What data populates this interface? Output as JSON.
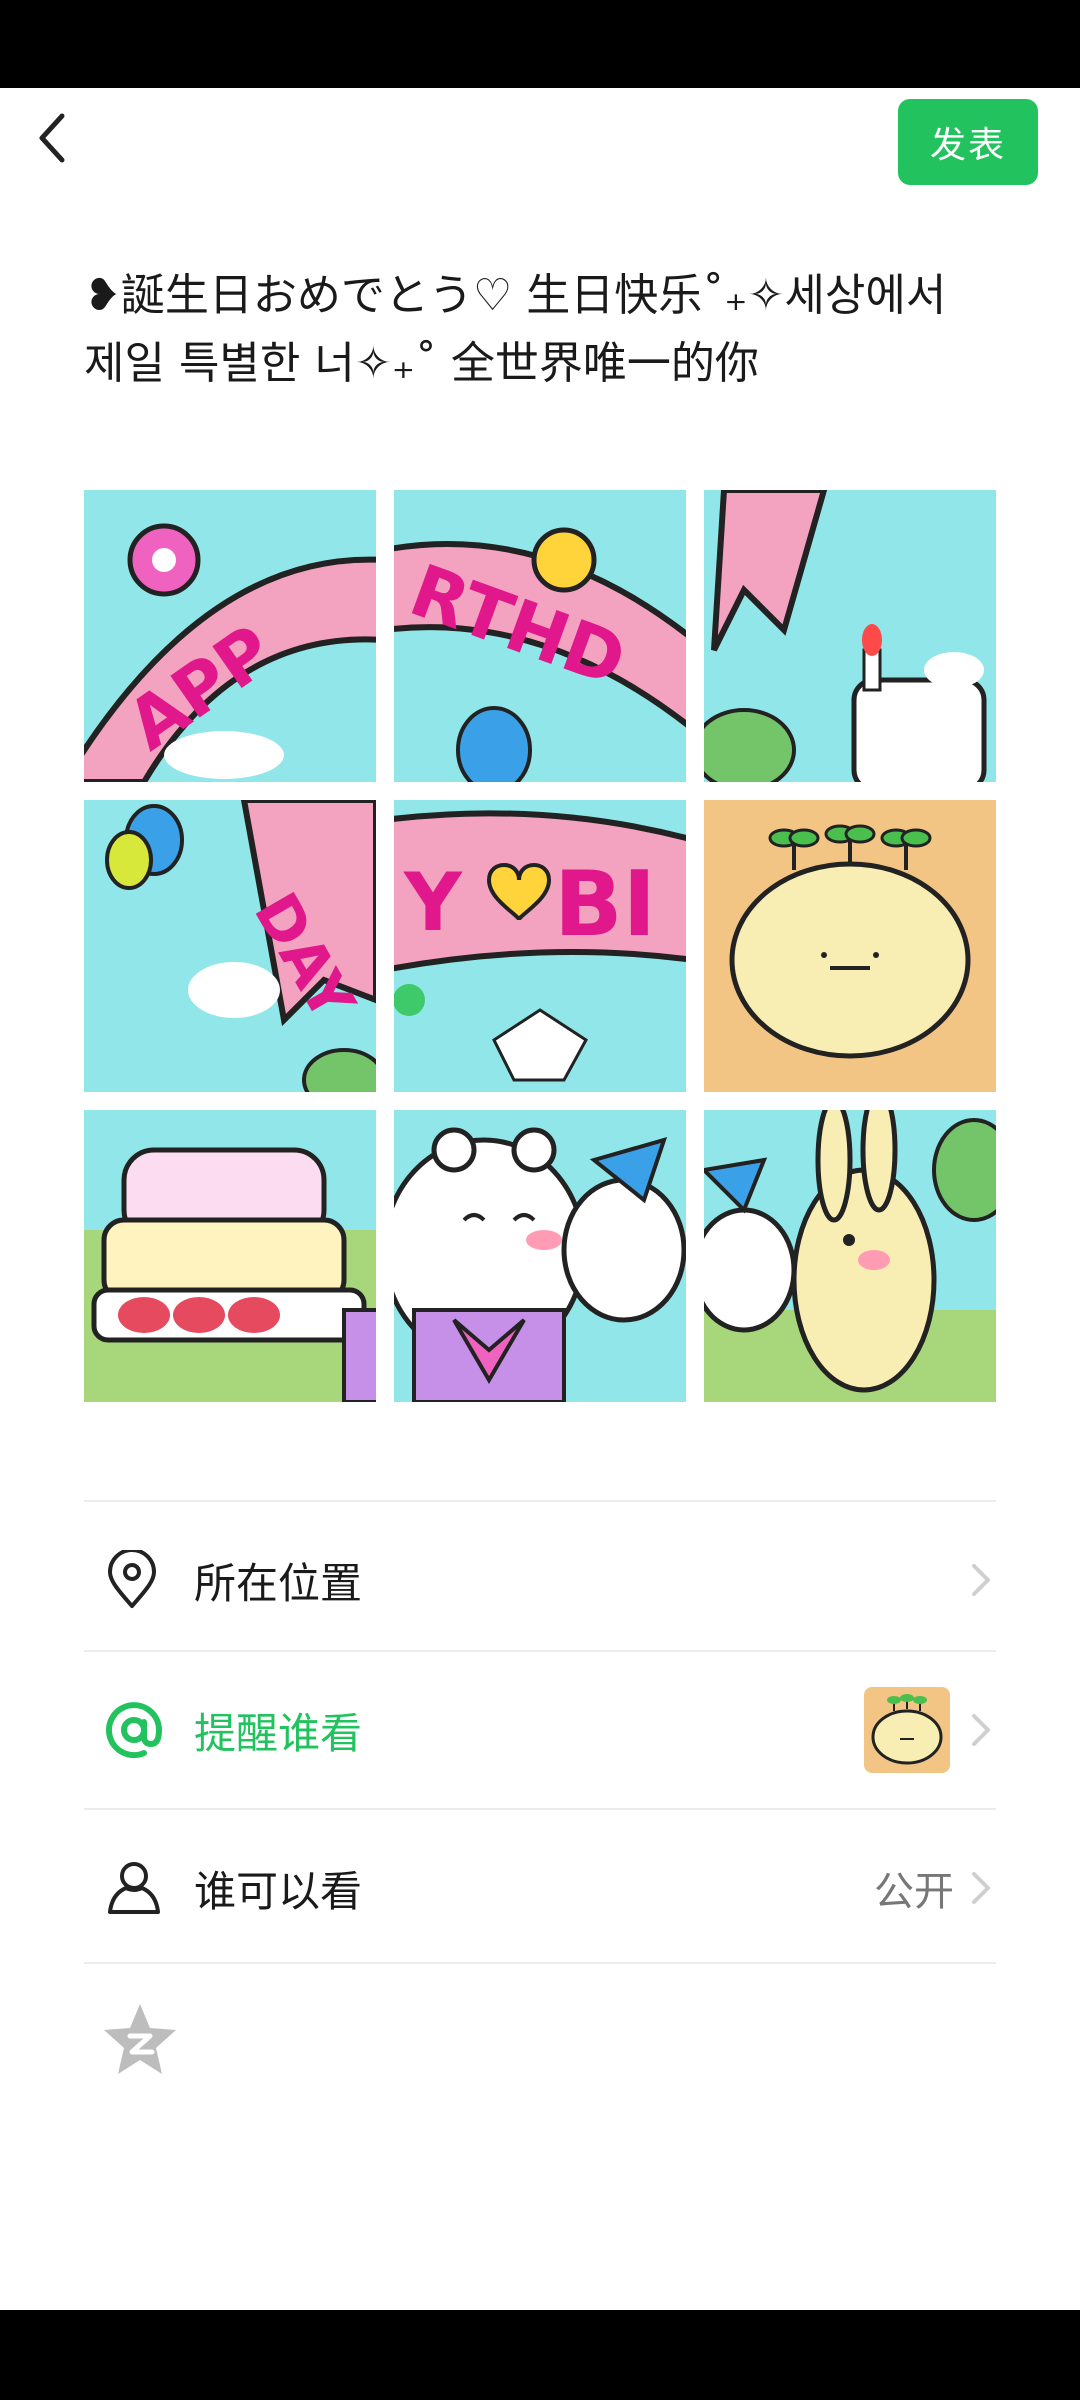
{
  "header": {
    "publish_label": "发表"
  },
  "post": {
    "text": "❥誕生日おめでとう♡ 生日快乐˚₊✧세상에서\n제일 특별한 너✧₊˚ 全世界唯一的你"
  },
  "options": {
    "location": {
      "label": "所在位置"
    },
    "mention": {
      "label": "提醒谁看"
    },
    "visibility": {
      "label": "谁可以看",
      "value": "公开"
    }
  },
  "colors": {
    "accent": "#22c35e",
    "sky": "#90e6e8",
    "banner": "#f3a3c0",
    "banner_text": "#e0188c",
    "tile_bg": "#f2c585"
  },
  "icons": [
    "back-arrow-icon",
    "location-pin-icon",
    "at-sign-icon",
    "person-icon",
    "qzone-star-icon",
    "chevron-right-icon"
  ]
}
